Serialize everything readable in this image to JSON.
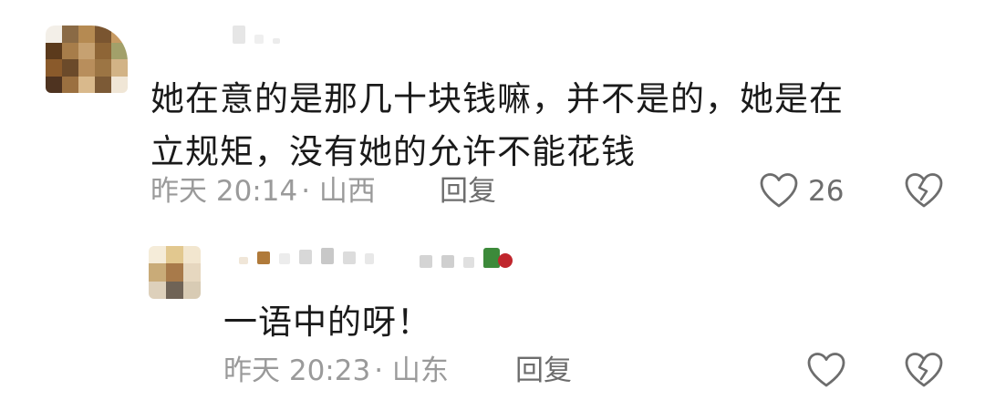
{
  "comments": [
    {
      "text_lines": [
        "她在意的是那几十块钱嘛，并不是的，她是在",
        "立规矩，没有她的允许不能花钱"
      ],
      "time": "昨天 20:14",
      "location": "· 山西",
      "reply_label": "回复",
      "like_count": "26",
      "like_icon": "heart-outline-icon",
      "dislike_icon": "broken-heart-icon"
    }
  ],
  "replies": [
    {
      "text": "一语中的呀！",
      "time": "昨天 20:23",
      "location": "· 山东",
      "reply_label": "回复",
      "like_icon": "heart-outline-icon",
      "dislike_icon": "broken-heart-icon"
    }
  ],
  "colors": {
    "text": "#1a1a1a",
    "meta": "#9a9a9a",
    "action": "#6d6d6d",
    "avatar_main_palette": [
      "#8a5a2b",
      "#c8a06a",
      "#5b3a1c",
      "#a77d4a",
      "#d9b98c",
      "#6b4a2a",
      "#b88e5c",
      "#9aa06b",
      "#f0e2c8",
      "#7a5530",
      "#c79a62",
      "#4e3320"
    ],
    "avatar_reply_palette": [
      "#e9d8bf",
      "#d6c6a8",
      "#b8a78a",
      "#c8b08a",
      "#a87a4a",
      "#e0d2bc",
      "#d0c2a8",
      "#6f6356",
      "#f2e9da"
    ]
  }
}
